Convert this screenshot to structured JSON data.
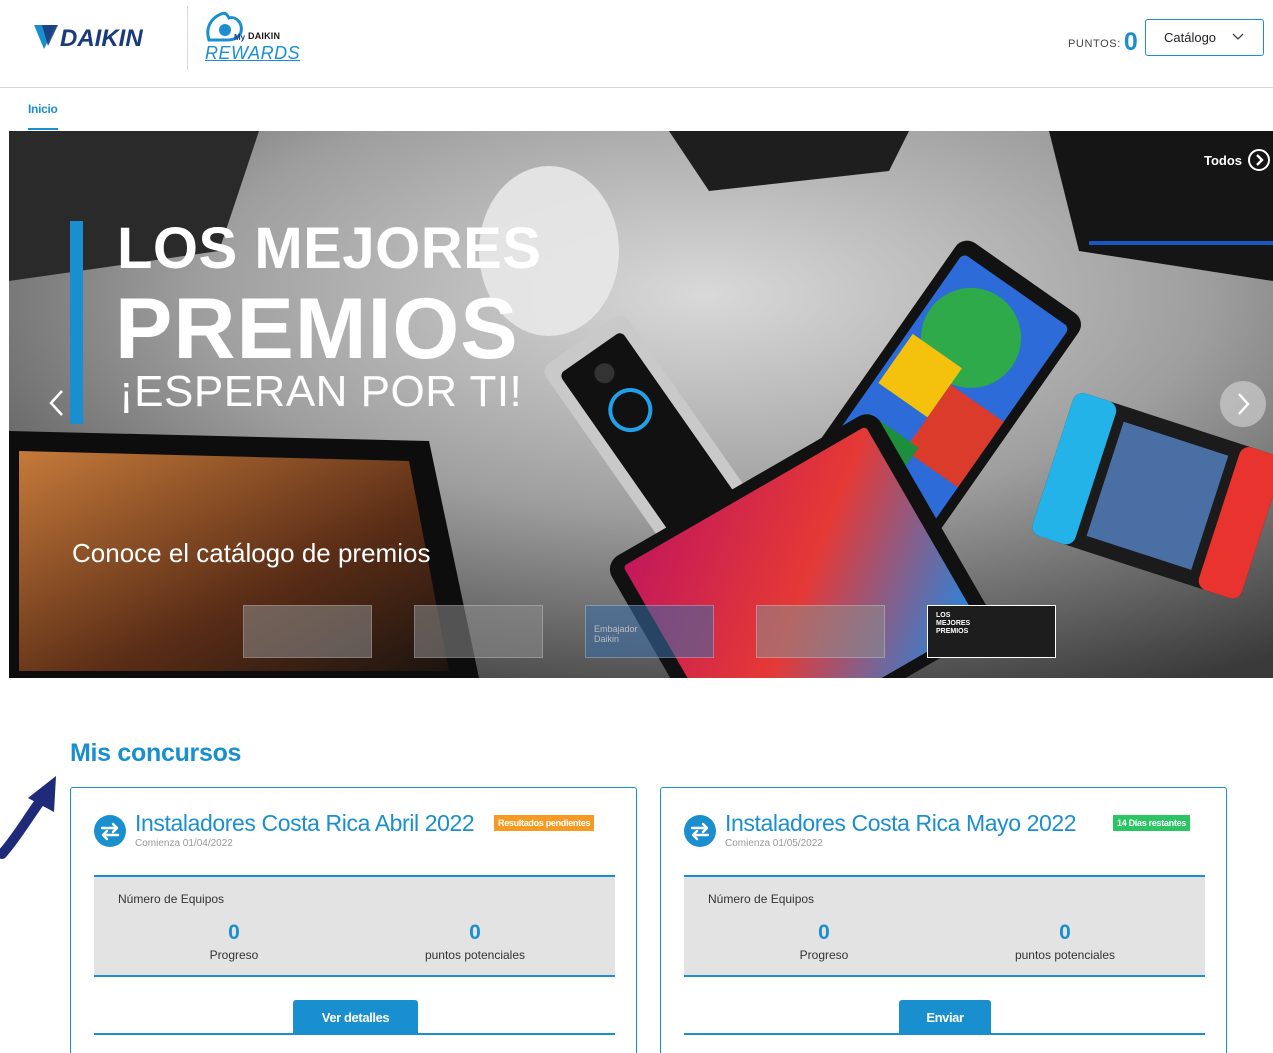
{
  "header": {
    "brand": "DAIKIN",
    "rewards_my": "My",
    "rewards_daikin": "DAIKIN",
    "rewards_text": "REWARDS",
    "points_label": "PUNTOS:",
    "points_value": "0",
    "catalog_label": "Catálogo"
  },
  "nav": {
    "tabs": [
      {
        "label": "Inicio",
        "active": true
      }
    ]
  },
  "banner": {
    "headline_1": "LOS MEJORES",
    "headline_2": "PREMIOS",
    "headline_3": "¡ESPERAN POR TI!",
    "subtitle": "Conoce el catálogo de premios",
    "todos_label": "Todos",
    "thumbnails": [
      {
        "caption": "",
        "active": false
      },
      {
        "caption": "",
        "active": false
      },
      {
        "caption": "Embajador Daikin",
        "active": false
      },
      {
        "caption": "",
        "active": false
      },
      {
        "caption": "LOS MEJORES PREMIOS",
        "active": true
      }
    ]
  },
  "section": {
    "title": "Mis concursos"
  },
  "contests": [
    {
      "title": "Instaladores Costa Rica Abril 2022",
      "date": "Comienza 01/04/2022",
      "badge": "Resultados pendientes",
      "badge_color": "#f59b23",
      "stats_label": "Número de Equipos",
      "progress_value": "0",
      "progress_label": "Progreso",
      "potential_value": "0",
      "potential_label": "puntos potenciales",
      "button_label": "Ver detalles"
    },
    {
      "title": "Instaladores Costa Rica Mayo 2022",
      "date": "Comienza 01/05/2022",
      "badge": "14 Días restantes",
      "badge_color": "#2cc566",
      "stats_label": "Número de Equipos",
      "progress_value": "0",
      "progress_label": "Progreso",
      "potential_value": "0",
      "potential_label": "puntos potenciales",
      "button_label": "Enviar"
    }
  ],
  "colors": {
    "accent": "#1a8fd0",
    "brand_dark": "#1a3b7a",
    "annotation_arrow": "#1f2a78"
  },
  "icons": [
    "daikin-logo",
    "rewards-logo",
    "chevron-down-icon",
    "chevron-right-circle-icon",
    "chevron-left-icon",
    "chevron-right-icon",
    "swap-arrows-icon",
    "annotation-arrow"
  ]
}
